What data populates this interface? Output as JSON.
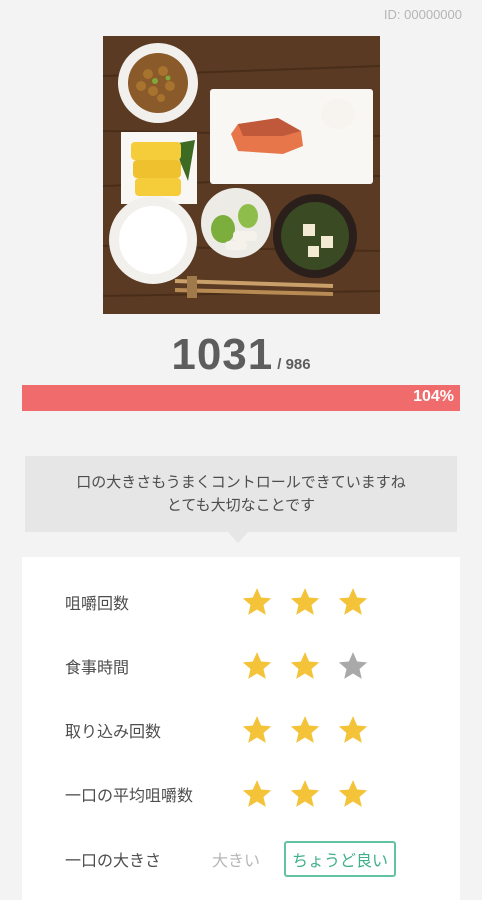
{
  "header": {
    "id_label": "ID: 00000000"
  },
  "score": {
    "value": "1031",
    "target": "/ 986",
    "percent_label": "104%",
    "progress_fraction": 1.0
  },
  "message": {
    "line1": "口の大きさもうまくコントロールできていますね",
    "line2": "とても大切なことです"
  },
  "metrics": [
    {
      "label": "咀嚼回数",
      "stars": [
        true,
        true,
        true
      ]
    },
    {
      "label": "食事時間",
      "stars": [
        true,
        true,
        false
      ]
    },
    {
      "label": "取り込み回数",
      "stars": [
        true,
        true,
        true
      ]
    },
    {
      "label": "一口の平均咀嚼数",
      "stars": [
        true,
        true,
        true
      ]
    }
  ],
  "bite_size": {
    "label": "一口の大きさ",
    "option_big": "大きい",
    "option_good": "ちょうど良い",
    "selected": "ちょうど良い"
  },
  "colors": {
    "accent_red": "#f06b6b",
    "star_gold": "#f3c33a",
    "star_gray": "#a9a9a9",
    "accent_green": "#62c2a3"
  },
  "icons": {
    "star_filled": "star-icon",
    "star_empty": "star-empty-icon"
  }
}
